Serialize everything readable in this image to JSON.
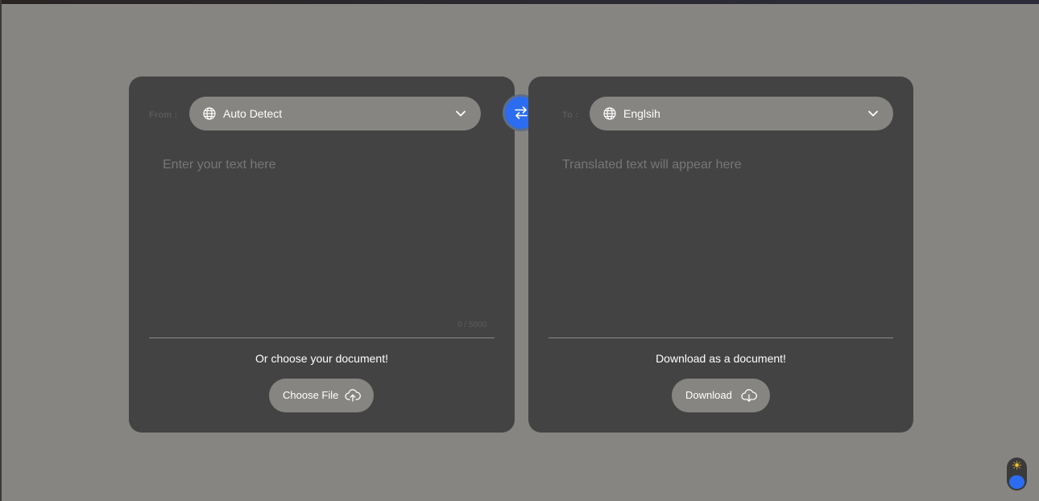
{
  "source": {
    "label": "From :",
    "language": "Auto Detect",
    "placeholder": "Enter your text here",
    "counter": "0 / 5000",
    "caption": "Or choose your document!",
    "button_label": "Choose File"
  },
  "target": {
    "label": "To :",
    "language": "Englsih",
    "placeholder": "Translated text will appear here",
    "caption": "Download as a document!",
    "button_label": "Download"
  },
  "colors": {
    "page_background": "#878582",
    "panel": "#434343",
    "accent": "#2b6cf0",
    "sun": "#f2c230"
  },
  "icons": {
    "language": "globe-icon",
    "dropdown": "chevron-down-icon",
    "swap": "swap-arrows-icon",
    "upload": "cloud-upload-icon",
    "download": "cloud-download-icon",
    "theme": "sun-icon"
  }
}
